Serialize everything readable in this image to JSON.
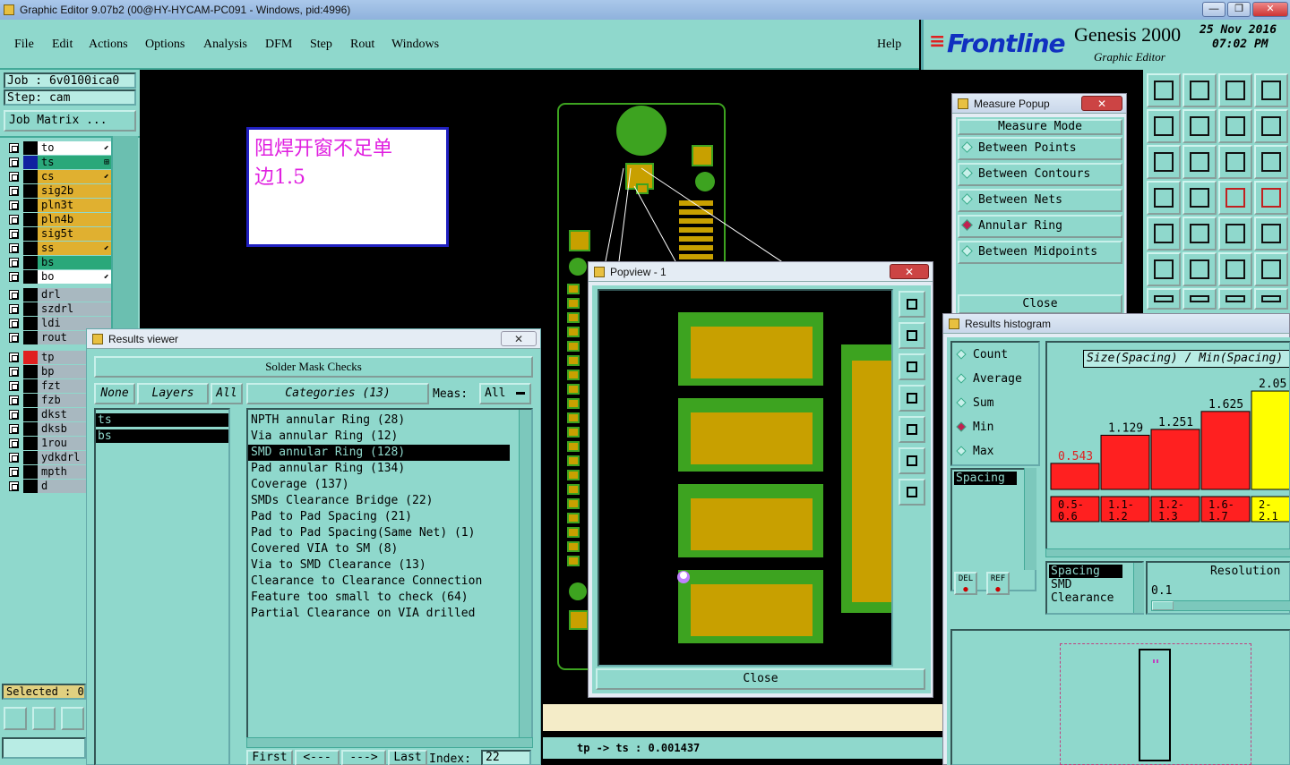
{
  "window": {
    "title": "Graphic Editor 9.07b2 (00@HY-HYCAM-PC091 - Windows, pid:4996)",
    "minimize": "—",
    "restore": "❐",
    "close": "✕"
  },
  "menu": {
    "items": [
      "File",
      "Edit",
      "Actions",
      "Options",
      "Analysis",
      "DFM",
      "Step",
      "Rout",
      "Windows"
    ],
    "help": "Help"
  },
  "branding": {
    "logo": "Frontline",
    "product": "Genesis 2000",
    "subtitle": "Graphic Editor",
    "date": "25 Nov 2016",
    "time": "07:02 PM"
  },
  "job": {
    "job_label": "Job  : 6v0100ica0",
    "step_label": "Step: cam",
    "matrix_button": "Job Matrix ..."
  },
  "layers": [
    {
      "name": "to",
      "color": "#ffffff",
      "mark": "⬋"
    },
    {
      "name": "ts",
      "color": "#2aa87a",
      "mark": "⊞"
    },
    {
      "name": "cs",
      "color": "#e0b030",
      "mark": "⬋"
    },
    {
      "name": "sig2b",
      "color": "#e0b030",
      "mark": ""
    },
    {
      "name": "pln3t",
      "color": "#e0b030",
      "mark": ""
    },
    {
      "name": "pln4b",
      "color": "#e0b030",
      "mark": ""
    },
    {
      "name": "sig5t",
      "color": "#e0b030",
      "mark": ""
    },
    {
      "name": "ss",
      "color": "#e0b030",
      "mark": "⬋"
    },
    {
      "name": "bs",
      "color": "#2aa87a",
      "mark": ""
    },
    {
      "name": "bo",
      "color": "#ffffff",
      "mark": "⬋"
    },
    {
      "name": "drl",
      "color": "#a8b8c0",
      "mark": ""
    },
    {
      "name": "szdrl",
      "color": "#a8b8c0",
      "mark": ""
    },
    {
      "name": "ldi",
      "color": "#a8b8c0",
      "mark": ""
    },
    {
      "name": "rout",
      "color": "#a8b8c0",
      "mark": ""
    },
    {
      "name": "tp",
      "color": "#a8b8c0",
      "mark": ""
    },
    {
      "name": "bp",
      "color": "#a8b8c0",
      "mark": ""
    },
    {
      "name": "fzt",
      "color": "#a8b8c0",
      "mark": ""
    },
    {
      "name": "fzb",
      "color": "#a8b8c0",
      "mark": ""
    },
    {
      "name": "dkst",
      "color": "#a8b8c0",
      "mark": ""
    },
    {
      "name": "dksb",
      "color": "#a8b8c0",
      "mark": ""
    },
    {
      "name": "1rou",
      "color": "#a8b8c0",
      "mark": ""
    },
    {
      "name": "ydkdrl",
      "color": "#a8b8c0",
      "mark": ""
    },
    {
      "name": "mpth",
      "color": "#a8b8c0",
      "mark": ""
    },
    {
      "name": "d",
      "color": "#a8b8c0",
      "mark": ""
    }
  ],
  "selected_label": "Selected : 0",
  "note": {
    "text_line1": "阻焊开窗不足单",
    "text_line2": "边1.5"
  },
  "results_viewer": {
    "title": "Results viewer",
    "header": "Solder Mask Checks",
    "none_btn": "None",
    "layers_label": "Layers",
    "all_btn": "All",
    "categories_label": "Categories (13)",
    "meas_label": "Meas:",
    "meas_value": "All",
    "layer_items": [
      "ts",
      "bs"
    ],
    "categories": [
      "NPTH annular Ring (28)",
      "Via annular Ring (12)",
      "SMD annular Ring (128)",
      "Pad annular Ring (134)",
      "Coverage (137)",
      "SMDs Clearance Bridge (22)",
      "Pad to Pad Spacing (21)",
      "Pad to Pad Spacing(Same Net) (1)",
      "Covered VIA to SM (8)",
      "Via to SMD Clearance (13)",
      "Clearance to Clearance Connection",
      "Feature too small to check (64)",
      "Partial Clearance on VIA drilled"
    ],
    "selected_index": 2,
    "nav": {
      "first": "First",
      "prev": "<---",
      "next": "--->",
      "last": "Last",
      "index_label": "Index:",
      "index_value": "22"
    }
  },
  "popview": {
    "title": "Popview - 1",
    "close_btn": "Close"
  },
  "status_bar": {
    "text": "tp -> ts : 0.001437"
  },
  "measure_popup": {
    "title": "Measure Popup",
    "mode_header": "Measure Mode",
    "modes": [
      "Between Points",
      "Between Contours",
      "Between Nets",
      "Annular Ring",
      "Between Midpoints"
    ],
    "selected_mode": 3,
    "close_btn": "Close"
  },
  "histogram": {
    "title": "Results histogram",
    "stat_options": [
      "Count",
      "Average",
      "Sum",
      "Min",
      "Max"
    ],
    "selected_stat": 3,
    "chart_title": "Size(Spacing) / Min(Spacing)",
    "measure_list_top": [
      "Spacing"
    ],
    "measure_list_bottom": [
      "Spacing",
      "SMD",
      "Clearance"
    ],
    "resolution_label": "Resolution",
    "resolution_value": "0.1",
    "del_btn": "DEL",
    "ref_btn": "REF"
  },
  "chart_data": {
    "type": "bar",
    "title": "Size(Spacing) / Min(Spacing)",
    "categories": [
      "0.5-0.6",
      "1.1-1.2",
      "1.2-1.3",
      "1.6-1.7",
      "2-2.1"
    ],
    "values": [
      0.543,
      1.129,
      1.251,
      1.625,
      2.05
    ],
    "colors": [
      "#ff2020",
      "#ff2020",
      "#ff2020",
      "#ff2020",
      "#ffff00"
    ],
    "ylim": [
      0,
      2.2
    ],
    "grid": false
  },
  "colors": {
    "panel": "#8fd8cc",
    "green_pad": "#3da320",
    "gold_pad": "#c8a000",
    "magenta_text": "#e020e0"
  }
}
